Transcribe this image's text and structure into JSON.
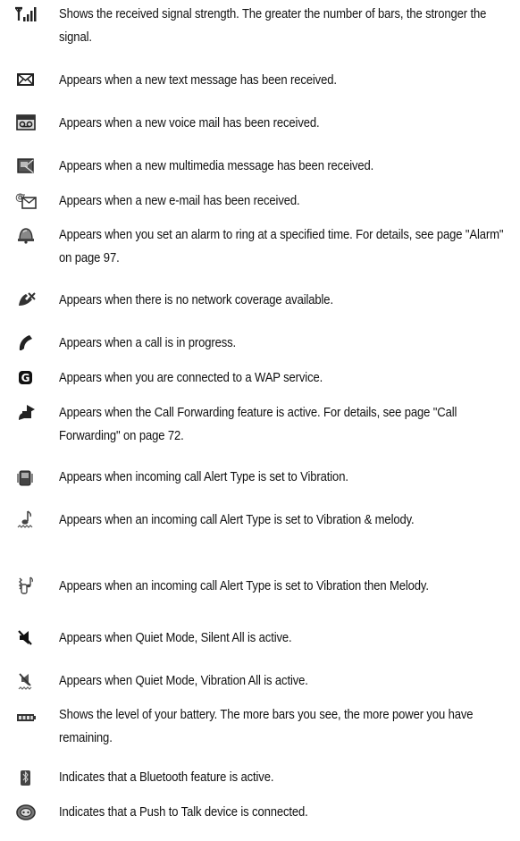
{
  "items": [
    {
      "icon": "signal-strength-icon",
      "text": "Shows the received signal strength. The greater the number of bars, the stronger the signal."
    },
    {
      "icon": "text-message-icon",
      "text": "Appears when a new text message has been received."
    },
    {
      "icon": "voice-mail-icon",
      "text": "Appears when a new voice mail has been received."
    },
    {
      "icon": "multimedia-message-icon",
      "text": "Appears when a new multimedia message has been received."
    },
    {
      "icon": "email-icon",
      "text": "Appears when a new e-mail has been received."
    },
    {
      "icon": "alarm-icon",
      "text": "Appears when you set an alarm to ring at a specified time. For details, see page \"Alarm\" on page 97."
    },
    {
      "icon": "no-network-icon",
      "text": "Appears when there is no network coverage available."
    },
    {
      "icon": "call-in-progress-icon",
      "text": "Appears when a call is in progress."
    },
    {
      "icon": "wap-service-icon",
      "text": "Appears when you are connected to a WAP service."
    },
    {
      "icon": "call-forwarding-icon",
      "text": "Appears when the Call Forwarding feature is active. For details, see page \"Call Forwarding\" on page 72."
    },
    {
      "icon": "vibration-icon",
      "text": "Appears when incoming call Alert Type is set to Vibration."
    },
    {
      "icon": "vibration-and-melody-icon",
      "text": "Appears when an incoming call Alert Type is set to Vibration & melody."
    },
    {
      "icon": "vibration-then-melody-icon",
      "text": "Appears when an incoming call Alert Type is set to Vibration then Melody."
    },
    {
      "icon": "silent-all-icon",
      "text": "Appears when Quiet Mode, Silent All is active."
    },
    {
      "icon": "vibration-all-icon",
      "text": "Appears when Quiet Mode, Vibration All is active."
    },
    {
      "icon": "battery-level-icon",
      "text": "Shows the level of your battery. The more bars you see, the more power you have remaining."
    },
    {
      "icon": "bluetooth-icon",
      "text": "Indicates that a Bluetooth feature is active."
    },
    {
      "icon": "push-to-talk-icon",
      "text": "Indicates that a Push to Talk device is connected."
    }
  ]
}
